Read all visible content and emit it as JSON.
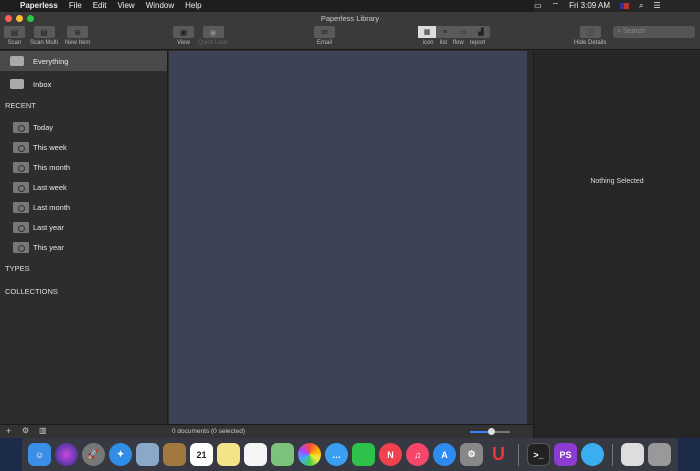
{
  "menubar": {
    "app": "Paperless",
    "items": [
      "File",
      "Edit",
      "View",
      "Window",
      "Help"
    ],
    "clock": "Fri 3:09 AM"
  },
  "window": {
    "title": "Paperless Library"
  },
  "toolbar": {
    "scan": "Scan",
    "scan_multi": "Scan Multi",
    "new_item": "New Item",
    "view": "View",
    "quick_look": "Quick Look",
    "email": "Email",
    "view_modes": [
      "icon",
      "list",
      "flow",
      "report"
    ],
    "hide_details": "Hide Details",
    "search_placeholder": "Search"
  },
  "sidebar": {
    "everything": "Everything",
    "inbox": "Inbox",
    "recent_header": "RECENT",
    "recent": [
      "Today",
      "This week",
      "This month",
      "Last week",
      "Last month",
      "Last year",
      "This year"
    ],
    "types_header": "TYPES",
    "collections_header": "COLLECTIONS"
  },
  "details": {
    "empty": "Nothing Selected"
  },
  "status": {
    "count": "0 documents (0 selected)"
  },
  "dock": {
    "calendar_day": "21",
    "items": [
      "Finder",
      "Siri",
      "Launchpad",
      "Safari",
      "Preview",
      "Contacts",
      "Calendar",
      "Notes",
      "Reminders",
      "Maps",
      "Photos",
      "Messages",
      "FaceTime",
      "News",
      "Music",
      "App Store",
      "System Preferences",
      "Magnet",
      "Terminal",
      "PhpStorm",
      "Android File Transfer",
      "Documents",
      "Trash"
    ]
  }
}
